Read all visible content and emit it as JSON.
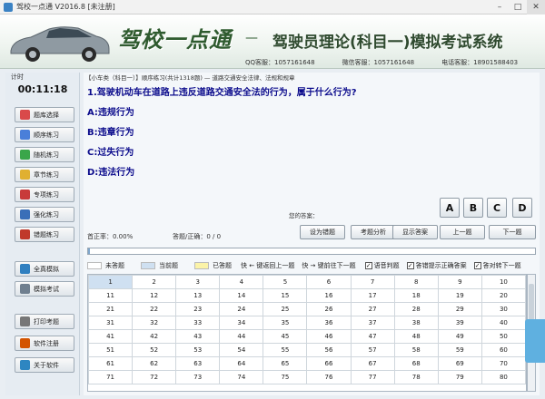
{
  "window": {
    "title": "驾校一点通 V2016.8 [未注册]"
  },
  "banner": {
    "brand": "驾校一点通",
    "dash": "—",
    "subtitle": "驾驶员理论(科目一)模拟考试系统",
    "qq": "QQ客服：1057161648",
    "wechat": "微信客服：1057161648",
    "phone": "电话客服：18901588403"
  },
  "sidebar": {
    "timer_label": "计时",
    "timer": "00:11:18",
    "buttons": [
      {
        "label": "题库选择",
        "color": "#d94a4a"
      },
      {
        "label": "顺序练习",
        "color": "#4a7fd9"
      },
      {
        "label": "随机练习",
        "color": "#3aa64a"
      },
      {
        "label": "章节练习",
        "color": "#e0b030"
      },
      {
        "label": "专项练习",
        "color": "#c83a3a"
      },
      {
        "label": "强化练习",
        "color": "#3a6fb8"
      },
      {
        "label": "错题练习",
        "color": "#c0392b"
      },
      {
        "label": "全真模拟",
        "color": "#2f7fc0"
      },
      {
        "label": "模拟考试",
        "color": "#6f7f8f"
      },
      {
        "label": "打印考题",
        "color": "#777777"
      },
      {
        "label": "软件注册",
        "color": "#d35400"
      },
      {
        "label": "关于软件",
        "color": "#2e86c1"
      }
    ]
  },
  "question": {
    "header": "【小车类（科目一）】顺序练习(共计1318题) — 道路交通安全法律、法规和规章",
    "text": "1.驾驶机动车在道路上违反道路交通安全法的行为，属于什么行为?",
    "options": [
      "A:违规行为",
      "B:违章行为",
      "C:过失行为",
      "D:违法行为"
    ]
  },
  "answer": {
    "label": "您的答案：",
    "choices": [
      "A",
      "B",
      "C",
      "D"
    ]
  },
  "stats": {
    "accuracy": "首正率：0.00%",
    "progress": "答题/正确：0 / 0"
  },
  "actions": [
    "设为错题",
    "考题分析",
    "显示答案",
    "上一题",
    "下一题"
  ],
  "progress_fraction": 0.005,
  "legend": {
    "unanswered": "未答题",
    "current": "当前题",
    "answered": "已答题",
    "key_prev": "快 ← 键返回上一题",
    "key_next": "快 → 键前往下一题",
    "voice": "语音判题",
    "show_correct": "答错提示正确答案",
    "auto_next": "答对转下一题",
    "colors": {
      "unanswered": "#ffffff",
      "current": "#cfe0f1",
      "answered": "#fbf3a8"
    }
  },
  "grid": {
    "rows": [
      [
        "1",
        "2",
        "3",
        "4",
        "5",
        "6",
        "7",
        "8",
        "9",
        "10"
      ],
      [
        "11",
        "12",
        "13",
        "14",
        "15",
        "16",
        "17",
        "18",
        "19",
        "20"
      ],
      [
        "21",
        "22",
        "23",
        "24",
        "25",
        "26",
        "27",
        "28",
        "29",
        "30"
      ],
      [
        "31",
        "32",
        "33",
        "34",
        "35",
        "36",
        "37",
        "38",
        "39",
        "40"
      ],
      [
        "41",
        "42",
        "43",
        "44",
        "45",
        "46",
        "47",
        "48",
        "49",
        "50"
      ],
      [
        "51",
        "52",
        "53",
        "54",
        "55",
        "56",
        "57",
        "58",
        "59",
        "60"
      ],
      [
        "61",
        "62",
        "63",
        "64",
        "65",
        "66",
        "67",
        "68",
        "69",
        "70"
      ],
      [
        "71",
        "72",
        "73",
        "74",
        "75",
        "76",
        "77",
        "78",
        "79",
        "80"
      ]
    ]
  }
}
